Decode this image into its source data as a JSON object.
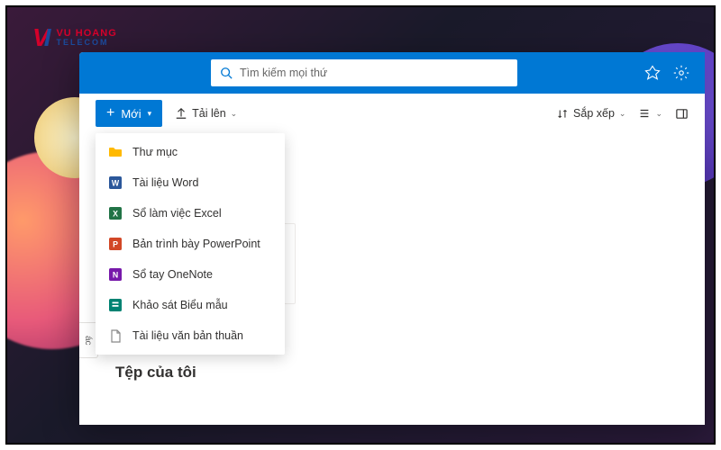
{
  "logo": {
    "brand": "VU HOANG",
    "sub": "TELECOM"
  },
  "header": {
    "search_placeholder": "Tìm kiếm mọi thứ"
  },
  "toolbar": {
    "new_label": "Mới",
    "upload_label": "Tải lên",
    "sort_label": "Sắp xếp"
  },
  "new_menu": {
    "items": [
      {
        "label": "Thư mục",
        "icon": "folder"
      },
      {
        "label": "Tài liệu Word",
        "icon": "word"
      },
      {
        "label": "Sổ làm việc Excel",
        "icon": "excel"
      },
      {
        "label": "Bản trình bày PowerPoint",
        "icon": "ppt"
      },
      {
        "label": "Sổ tay OneNote",
        "icon": "onenote"
      },
      {
        "label": "Khảo sát Biểu mẫu",
        "icon": "forms"
      },
      {
        "label": "Tài liệu văn bản thuần",
        "icon": "text"
      }
    ]
  },
  "sidebar_tab": "ác",
  "section_title": "Tệp của tôi"
}
